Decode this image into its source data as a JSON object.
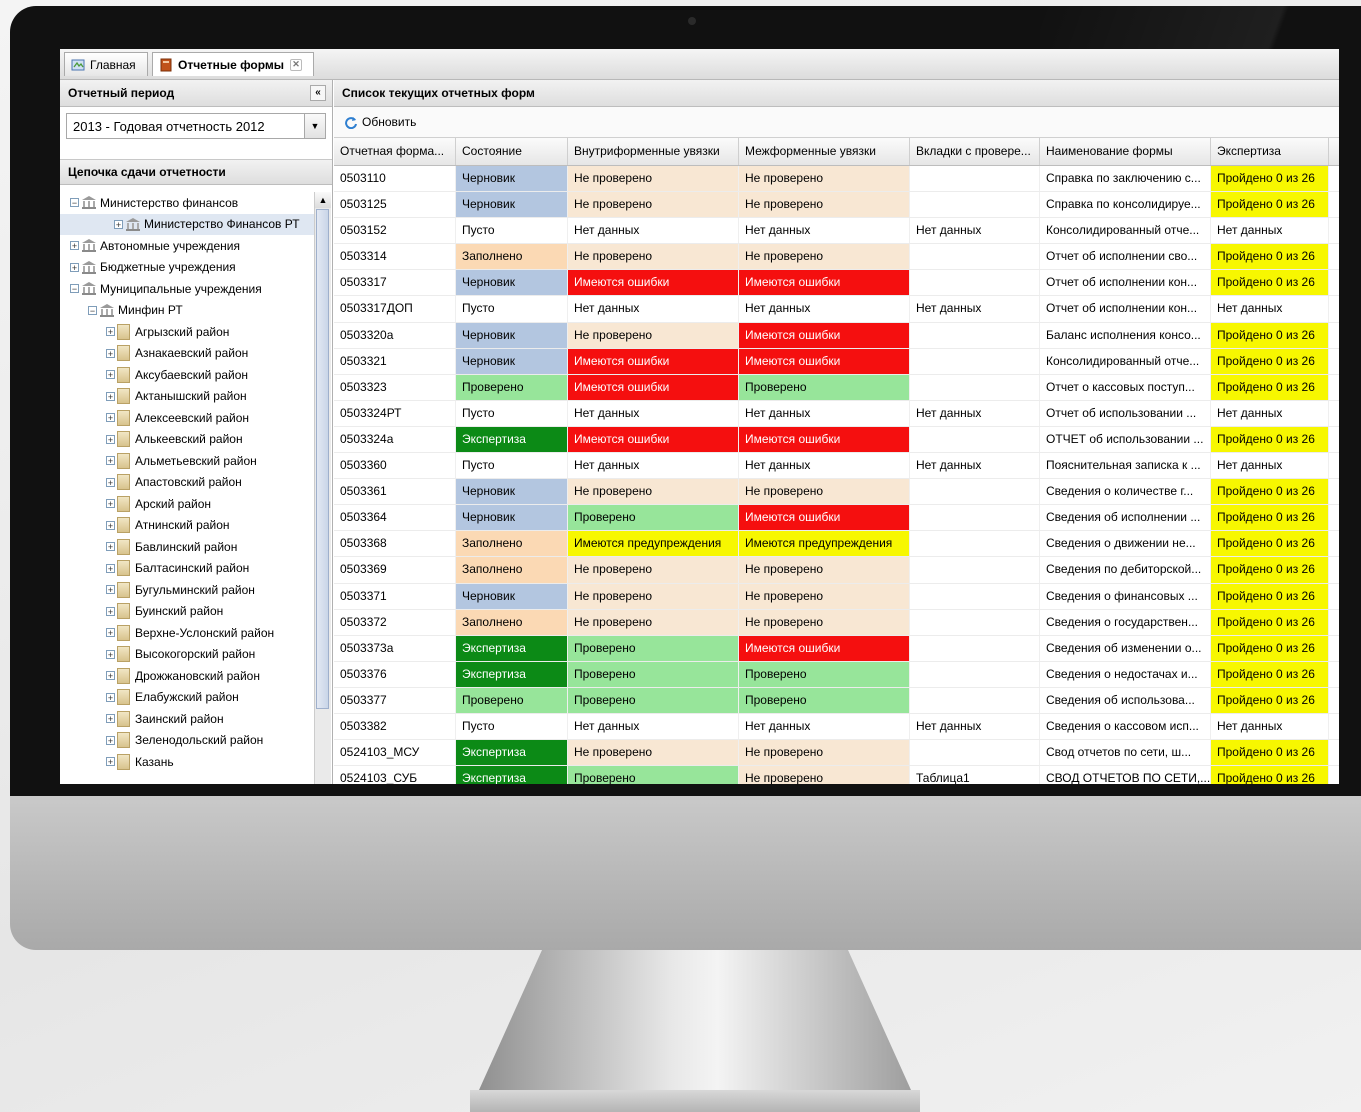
{
  "tabs": [
    {
      "label": "Главная",
      "icon": "home-icon"
    },
    {
      "label": "Отчетные формы",
      "icon": "book-icon"
    }
  ],
  "left": {
    "period_header": "Отчетный период",
    "period_value": "2013 - Годовая отчетность 2012",
    "chain_header": "Цепочка сдачи отчетности",
    "tree": [
      {
        "label": "Министерство финансов",
        "level": 0,
        "exp": "-",
        "icon": "bank"
      },
      {
        "label": "Министерство Финансов РТ",
        "level": 1,
        "exp": "+",
        "icon": "bank",
        "selected": true
      },
      {
        "label": "Автономные учреждения",
        "level": 0,
        "exp": "+",
        "icon": "bank"
      },
      {
        "label": "Бюджетные учреждения",
        "level": 0,
        "exp": "+",
        "icon": "bank"
      },
      {
        "label": "Муниципальные учреждения",
        "level": 0,
        "exp": "-",
        "icon": "bank"
      },
      {
        "label": "Минфин РТ",
        "level": 1,
        "exp": "-",
        "icon": "bank"
      },
      {
        "label": "Агрызский район",
        "level": 2,
        "exp": "+",
        "icon": "building"
      },
      {
        "label": "Азнакаевский район",
        "level": 2,
        "exp": "+",
        "icon": "building"
      },
      {
        "label": "Аксубаевский район",
        "level": 2,
        "exp": "+",
        "icon": "building"
      },
      {
        "label": "Актанышский район",
        "level": 2,
        "exp": "+",
        "icon": "building"
      },
      {
        "label": "Алексеевский район",
        "level": 2,
        "exp": "+",
        "icon": "building"
      },
      {
        "label": "Алькеевский район",
        "level": 2,
        "exp": "+",
        "icon": "building"
      },
      {
        "label": "Альметьевский район",
        "level": 2,
        "exp": "+",
        "icon": "building"
      },
      {
        "label": "Апастовский район",
        "level": 2,
        "exp": "+",
        "icon": "building"
      },
      {
        "label": "Арский район",
        "level": 2,
        "exp": "+",
        "icon": "building"
      },
      {
        "label": "Атнинский район",
        "level": 2,
        "exp": "+",
        "icon": "building"
      },
      {
        "label": "Бавлинский район",
        "level": 2,
        "exp": "+",
        "icon": "building"
      },
      {
        "label": "Балтасинский район",
        "level": 2,
        "exp": "+",
        "icon": "building"
      },
      {
        "label": "Бугульминский район",
        "level": 2,
        "exp": "+",
        "icon": "building"
      },
      {
        "label": "Буинский район",
        "level": 2,
        "exp": "+",
        "icon": "building"
      },
      {
        "label": "Верхне-Услонский район",
        "level": 2,
        "exp": "+",
        "icon": "building"
      },
      {
        "label": "Высокогорский район",
        "level": 2,
        "exp": "+",
        "icon": "building"
      },
      {
        "label": "Дрожжановский район",
        "level": 2,
        "exp": "+",
        "icon": "building"
      },
      {
        "label": "Елабужский район",
        "level": 2,
        "exp": "+",
        "icon": "building"
      },
      {
        "label": "Заинский район",
        "level": 2,
        "exp": "+",
        "icon": "building"
      },
      {
        "label": "Зеленодольский район",
        "level": 2,
        "exp": "+",
        "icon": "building"
      },
      {
        "label": "Казань",
        "level": 2,
        "exp": "+",
        "icon": "building"
      }
    ]
  },
  "right": {
    "header": "Список текущих отчетных форм",
    "refresh_label": "Обновить",
    "columns": [
      "Отчетная форма...",
      "Состояние",
      "Внутриформенные увязки",
      "Межформенные увязки",
      "Вкладки с провере...",
      "Наименование формы",
      "Экспертиза"
    ],
    "rows": [
      [
        "0503110",
        "Черновик",
        "Не проверено",
        "Не проверено",
        "",
        "Справка по заключению с...",
        "Пройдено 0 из 26"
      ],
      [
        "0503125",
        "Черновик",
        "Не проверено",
        "Не проверено",
        "",
        "Справка по консолидируе...",
        "Пройдено 0 из 26"
      ],
      [
        "0503152",
        "Пусто",
        "Нет данных",
        "Нет данных",
        "Нет данных",
        "Консолидированный отче...",
        "Нет данных"
      ],
      [
        "0503314",
        "Заполнено",
        "Не проверено",
        "Не проверено",
        "",
        "Отчет об исполнении сво...",
        "Пройдено 0 из 26"
      ],
      [
        "0503317",
        "Черновик",
        "Имеются ошибки",
        "Имеются ошибки",
        "",
        "Отчет об исполнении кон...",
        "Пройдено 0 из 26"
      ],
      [
        "0503317ДОП",
        "Пусто",
        "Нет данных",
        "Нет данных",
        "Нет данных",
        "Отчет об исполнении кон...",
        "Нет данных"
      ],
      [
        "0503320а",
        "Черновик",
        "Не проверено",
        "Имеются ошибки",
        "",
        "Баланс исполнения консо...",
        "Пройдено 0 из 26"
      ],
      [
        "0503321",
        "Черновик",
        "Имеются ошибки",
        "Имеются ошибки",
        "",
        "Консолидированный отче...",
        "Пройдено 0 из 26"
      ],
      [
        "0503323",
        "Проверено",
        "Имеются ошибки",
        "Проверено",
        "",
        "Отчет о кассовых поступ...",
        "Пройдено 0 из 26"
      ],
      [
        "0503324РТ",
        "Пусто",
        "Нет данных",
        "Нет данных",
        "Нет данных",
        "Отчет об использовании ...",
        "Нет данных"
      ],
      [
        "0503324а",
        "Экспертиза",
        "Имеются ошибки",
        "Имеются ошибки",
        "",
        "ОТЧЕТ об использовании ...",
        "Пройдено 0 из 26"
      ],
      [
        "0503360",
        "Пусто",
        "Нет данных",
        "Нет данных",
        "Нет данных",
        "Пояснительная записка к ...",
        "Нет данных"
      ],
      [
        "0503361",
        "Черновик",
        "Не проверено",
        "Не проверено",
        "",
        "Сведения о количестве г...",
        "Пройдено 0 из 26"
      ],
      [
        "0503364",
        "Черновик",
        "Проверено",
        "Имеются ошибки",
        "",
        "Сведения об исполнении ...",
        "Пройдено 0 из 26"
      ],
      [
        "0503368",
        "Заполнено",
        "Имеются предупреждения",
        "Имеются предупреждения",
        "",
        "Сведения о движении не...",
        "Пройдено 0 из 26"
      ],
      [
        "0503369",
        "Заполнено",
        "Не проверено",
        "Не проверено",
        "",
        "Сведения по дебиторской...",
        "Пройдено 0 из 26"
      ],
      [
        "0503371",
        "Черновик",
        "Не проверено",
        "Не проверено",
        "",
        "Сведения о финансовых ...",
        "Пройдено 0 из 26"
      ],
      [
        "0503372",
        "Заполнено",
        "Не проверено",
        "Не проверено",
        "",
        "Сведения о государствен...",
        "Пройдено 0 из 26"
      ],
      [
        "0503373а",
        "Экспертиза",
        "Проверено",
        "Имеются ошибки",
        "",
        "Сведения об изменении о...",
        "Пройдено 0 из 26"
      ],
      [
        "0503376",
        "Экспертиза",
        "Проверено",
        "Проверено",
        "",
        "Сведения о недостачах и...",
        "Пройдено 0 из 26"
      ],
      [
        "0503377",
        "Проверено",
        "Проверено",
        "Проверено",
        "",
        "Сведения об использова...",
        "Пройдено 0 из 26"
      ],
      [
        "0503382",
        "Пусто",
        "Нет данных",
        "Нет данных",
        "Нет данных",
        "Сведения о кассовом исп...",
        "Нет данных"
      ],
      [
        "0524103_МСУ",
        "Экспертиза",
        "Не проверено",
        "Не проверено",
        "",
        "Свод отчетов по сети, ш...",
        "Пройдено 0 из 26"
      ],
      [
        "0524103_СУБ",
        "Экспертиза",
        "Проверено",
        "Не проверено",
        "Таблица1",
        "СВОД ОТЧЕТОВ ПО СЕТИ,...",
        "Пройдено 0 из 26"
      ]
    ]
  },
  "colors": {
    "draft": "#b3c6e0",
    "filled": "#fbd9b4",
    "checked": "#97e59a",
    "expertise": "#0c8a16",
    "errors": "#f50f0f",
    "warnings": "#f7f700",
    "not_checked": "#f8e7d3",
    "passed": "#f7f700"
  }
}
